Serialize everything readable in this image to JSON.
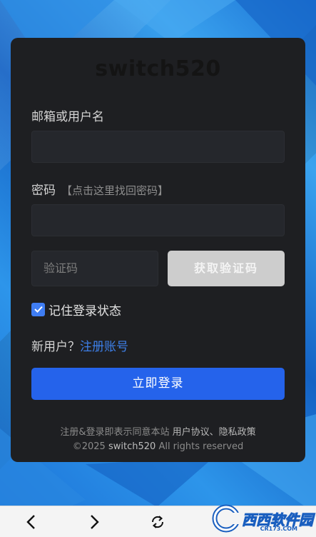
{
  "logo": "switch520",
  "email_label": "邮箱或用户名",
  "password_label": "密码",
  "password_hint": "【点击这里找回密码】",
  "captcha_placeholder": "验证码",
  "captcha_button": "获取验证码",
  "remember_label": "记住登录状态",
  "newuser_prefix": "新用户？",
  "register_link": "注册账号",
  "login_button": "立即登录",
  "agree_prefix": "注册&登录即表示同意本站",
  "agree_links": "用户协议、隐私政策",
  "copyright_prefix": "©2025",
  "copyright_brand": "switch520",
  "copyright_suffix": "All rights reserved",
  "watermark_brand": "西西软件园",
  "watermark_url": "CR173.COM",
  "colors": {
    "primary": "#2563eb",
    "link": "#3d7fe8",
    "card": "#1e1f22"
  },
  "icons": {
    "back": "chevron-left-icon",
    "forward": "chevron-right-icon",
    "refresh": "refresh-icon"
  }
}
